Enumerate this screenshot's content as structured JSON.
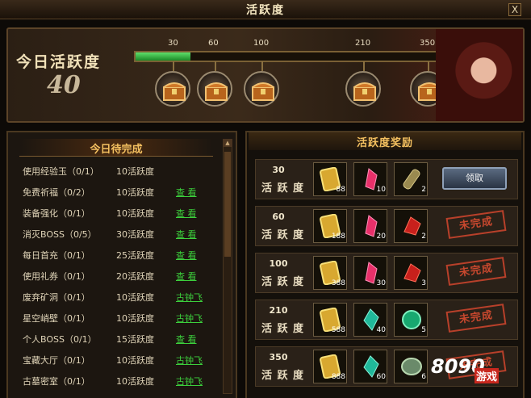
{
  "window": {
    "title": "活跃度",
    "close_label": "X"
  },
  "summary": {
    "label": "今日活跃度",
    "value": "40",
    "progress_fraction": 0.18
  },
  "milestones": [
    {
      "label": "30"
    },
    {
      "label": "60"
    },
    {
      "label": "100"
    },
    {
      "label": "210"
    },
    {
      "label": "350"
    }
  ],
  "tasks": {
    "title": "今日待完成",
    "items": [
      {
        "name": "使用经验玉（0/1）",
        "points": "10活跃度",
        "action": ""
      },
      {
        "name": "免费祈福（0/2）",
        "points": "10活跃度",
        "action": "查 看"
      },
      {
        "name": "装备强化（0/1）",
        "points": "10活跃度",
        "action": "查 看"
      },
      {
        "name": "消灭BOSS（0/5）",
        "points": "30活跃度",
        "action": "查 看"
      },
      {
        "name": "每日首充（0/1）",
        "points": "25活跃度",
        "action": "查 看"
      },
      {
        "name": "使用礼券（0/1）",
        "points": "20活跃度",
        "action": "查 看"
      },
      {
        "name": "废弃矿洞（0/1）",
        "points": "10活跃度",
        "action": "古钟飞"
      },
      {
        "name": "星空峭壁（0/1）",
        "points": "10活跃度",
        "action": "古钟飞"
      },
      {
        "name": "个人BOSS（0/1）",
        "points": "15活跃度",
        "action": "查 看"
      },
      {
        "name": "宝藏大厅（0/1）",
        "points": "10活跃度",
        "action": "古钟飞"
      },
      {
        "name": "古墓密室（0/1）",
        "points": "10活跃度",
        "action": "古钟飞"
      }
    ]
  },
  "rewards": {
    "title": "活跃度奖励",
    "row_label": "活 跃 度",
    "claim_label": "领取",
    "incomplete_label": "未完成",
    "rows": [
      {
        "points": "30",
        "slot1": "88",
        "slot2": "10",
        "slot3": "2",
        "status": "claim"
      },
      {
        "points": "60",
        "slot1": "188",
        "slot2": "20",
        "slot3": "2",
        "status": "incomplete"
      },
      {
        "points": "100",
        "slot1": "388",
        "slot2": "30",
        "slot3": "3",
        "status": "incomplete"
      },
      {
        "points": "210",
        "slot1": "588",
        "slot2": "40",
        "slot3": "5",
        "status": "incomplete"
      },
      {
        "points": "350",
        "slot1": "888",
        "slot2": "60",
        "slot3": "6",
        "status": "incomplete"
      }
    ]
  },
  "branding": {
    "logo_num": "8090",
    "logo_text": "游戏"
  }
}
